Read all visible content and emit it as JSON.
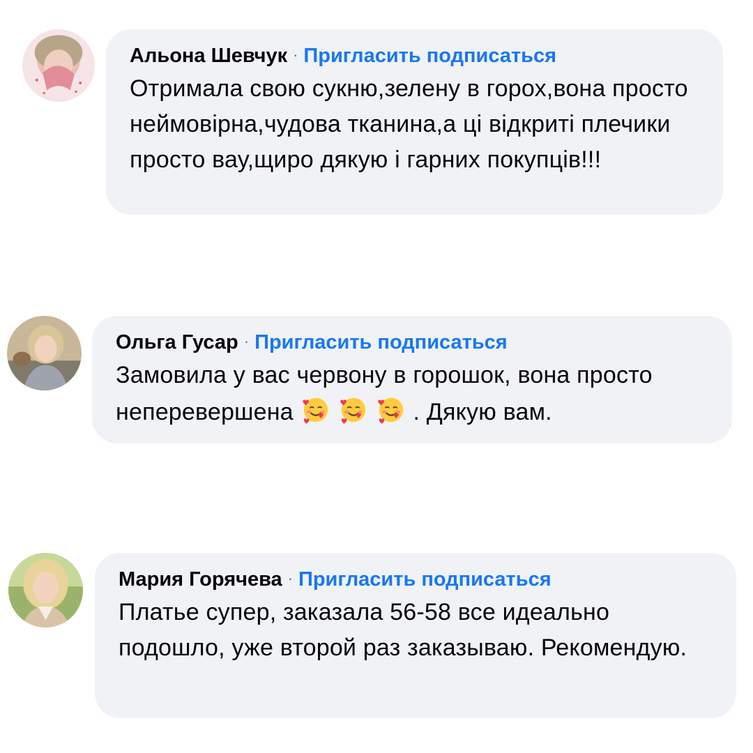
{
  "comments": [
    {
      "author": "Альона Шевчук",
      "separator": "·",
      "invite_label": "Пригласить подписаться",
      "text": "Отримала свою сукню,зелену в горох,вона просто неймовірна,чудова тканина,а ці відкриті плечики просто вау,щиро дякую і гарних покупців!!!"
    },
    {
      "author": "Ольга Гусар",
      "separator": "·",
      "invite_label": "Пригласить подписаться",
      "text_before": "Замовила у вас червону в горошок, вона просто неперевершена",
      "emoji": [
        "smiling-face-with-hearts",
        "smiling-face-with-hearts",
        "smiling-face-with-hearts"
      ],
      "text_after": ". Дякую вам."
    },
    {
      "author": "Мария Горячева",
      "separator": "·",
      "invite_label": "Пригласить подписаться",
      "text": "Платье супер, заказала 56-58 все идеально подошло, уже второй раз заказываю. Рекомендую."
    }
  ],
  "colors": {
    "bubble_bg": "#f0f2f5",
    "link_blue": "#1877f2",
    "text": "#050505",
    "muted": "#65676b"
  }
}
